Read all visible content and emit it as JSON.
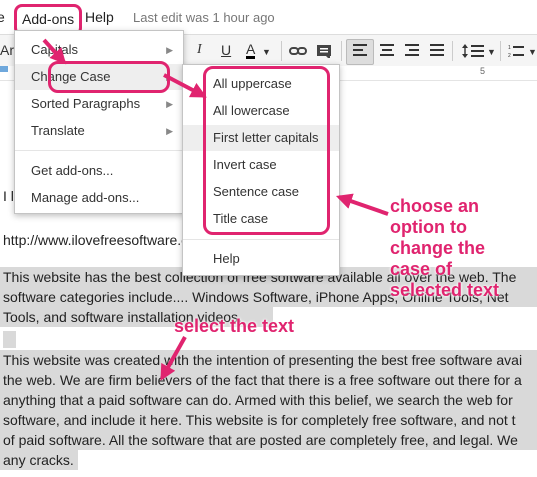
{
  "menubar": {
    "partial_prev": "e",
    "addons": "Add-ons",
    "help": "Help",
    "last_edit": "Last edit was 1 hour ago"
  },
  "toolbar": {
    "font_partial": "Ari",
    "italic": "I",
    "underline": "U",
    "text_color": "A",
    "ruler_number": "5"
  },
  "addons_menu": {
    "items": [
      {
        "label": "Capitals",
        "has_submenu": true
      },
      {
        "label": "Change Case",
        "has_submenu": true,
        "active": true
      },
      {
        "label": "Sorted Paragraphs",
        "has_submenu": true
      },
      {
        "label": "Translate",
        "has_submenu": true
      },
      {
        "label": "Get add-ons..."
      },
      {
        "label": "Manage add-ons..."
      }
    ]
  },
  "change_case_menu": {
    "items": [
      "All uppercase",
      "All lowercase",
      "First letter capitals",
      "Invert case",
      "Sentence case",
      "Title case"
    ],
    "help": "Help"
  },
  "document": {
    "line1_partial": "I l",
    "url": "http://www.ilovefreesoftware.com",
    "para1": [
      "This website has the best collection of free software available all over the web. The",
      "software categories include.... Windows Software, iPhone Apps, Online Tools, Net",
      "Tools, and software installation videos."
    ],
    "para2": [
      "This website was created with the intention of presenting the best free software avai",
      "the web. We are firm believers of the fact that there is a free software out there for a",
      "anything that a paid software can do. Armed with this belief, we search the web for",
      "software, and include it here. This website is for completely free software, and not t",
      "of paid software. All the software that are posted are completely free, and legal. We",
      "any cracks."
    ]
  },
  "annotations": {
    "choose": [
      "choose an",
      "option to",
      "change the",
      "case of",
      "selected text"
    ],
    "select": "select the text"
  },
  "colors": {
    "accent": "#e0246f",
    "selection": "#d9d9d9"
  }
}
